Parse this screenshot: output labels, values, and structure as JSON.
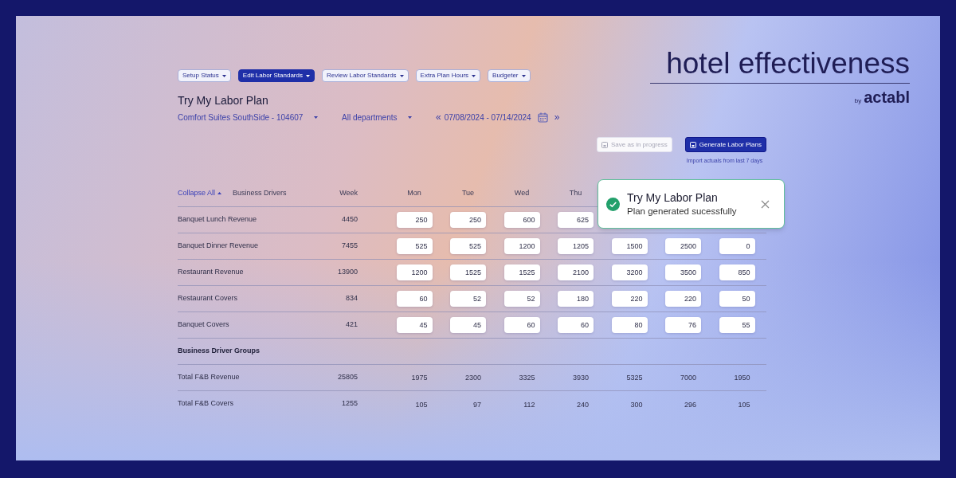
{
  "logo": {
    "name": "hotel effectiveness",
    "by": "by",
    "brand": "actabl"
  },
  "nav": [
    {
      "label": "Setup Status",
      "selected": false
    },
    {
      "label": "Edit Labor Standards",
      "selected": true
    },
    {
      "label": "Review Labor Standards",
      "selected": false
    },
    {
      "label": "Extra Plan Hours",
      "selected": false
    },
    {
      "label": "Budgeter",
      "selected": false
    }
  ],
  "title": "Try My Labor Plan",
  "filters": {
    "property": "Comfort Suites SouthSide - 104607",
    "department": "All departments",
    "prev": "«",
    "date_range": "07/08/2024 - 07/14/2024",
    "next": "»"
  },
  "actions": [
    {
      "label": "Save as in progress",
      "disabled": true
    },
    {
      "label": "Generate Labor Plans",
      "disabled": false
    }
  ],
  "hint": "Import actuals from last 7 days",
  "table": {
    "collapse": "Collapse All",
    "columns": [
      "Business Drivers",
      "Week",
      "Mon",
      "Tue",
      "Wed",
      "Thu"
    ],
    "rows": [
      {
        "name": "Banquet Lunch Revenue",
        "week": "4450",
        "values": [
          "250",
          "250",
          "600",
          "625"
        ]
      },
      {
        "name": "Banquet Dinner Revenue",
        "week": "7455",
        "values": [
          "525",
          "525",
          "1200",
          "1205",
          "1500",
          "2500",
          "0"
        ]
      },
      {
        "name": "Restaurant Revenue",
        "week": "13900",
        "values": [
          "1200",
          "1525",
          "1525",
          "2100",
          "3200",
          "3500",
          "850"
        ]
      },
      {
        "name": "Restaurant Covers",
        "week": "834",
        "values": [
          "60",
          "52",
          "52",
          "180",
          "220",
          "220",
          "50"
        ]
      },
      {
        "name": "Banquet Covers",
        "week": "421",
        "values": [
          "45",
          "45",
          "60",
          "60",
          "80",
          "76",
          "55"
        ]
      }
    ],
    "group_heading": "Business Driver Groups",
    "group_rows": [
      {
        "name": "Total F&B Revenue",
        "week": "25805",
        "values": [
          "1975",
          "2300",
          "3325",
          "3930",
          "5325",
          "7000",
          "1950"
        ]
      },
      {
        "name": "Total F&B Covers",
        "week": "1255",
        "values": [
          "105",
          "97",
          "112",
          "240",
          "300",
          "296",
          "105"
        ]
      }
    ]
  },
  "toast": {
    "title": "Try My Labor Plan",
    "message": "Plan generated sucessfully"
  }
}
